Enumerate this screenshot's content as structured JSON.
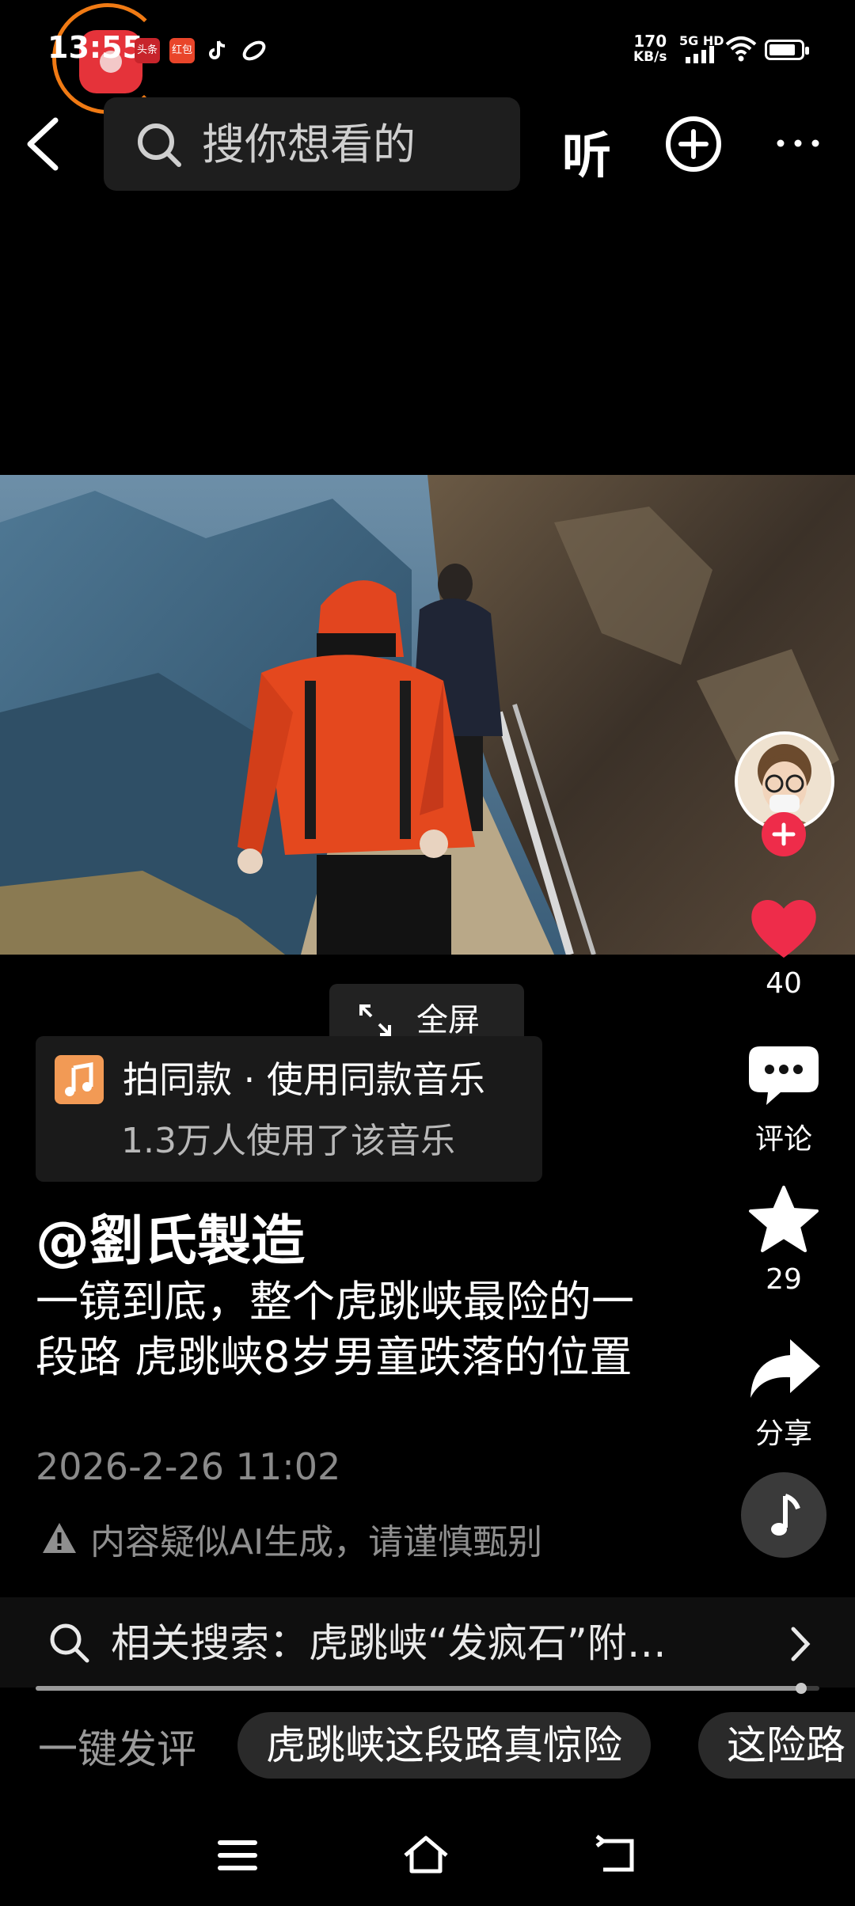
{
  "status_bar": {
    "time": "13:55",
    "net_speed_value": "170",
    "net_speed_unit": "KB/s",
    "network": "5G HD",
    "mini_apps": [
      "头条",
      "红包",
      "TikTok",
      "Link"
    ]
  },
  "top_bar": {
    "search_placeholder": "搜你想看的",
    "listen_label": "听"
  },
  "video": {
    "fullscreen_label": "全屏"
  },
  "right_rail": {
    "like_count": "40",
    "comment_label": "评论",
    "favorite_count": "29",
    "share_label": "分享"
  },
  "music_card": {
    "title": "拍同款 · 使用同款音乐",
    "subtitle": "1.3万人使用了该音乐"
  },
  "post": {
    "author": "@劉氏製造",
    "description": "一镜到底，整个虎跳峡最险的一段路 虎跳峡8岁男童跌落的位置",
    "date": "2026-2-26 11:02",
    "ai_notice": "内容疑似AI生成，请谨慎甄别"
  },
  "related_search": {
    "text": "相关搜索：虎跳峡“发疯石”附…"
  },
  "progress": {
    "fraction": 0.976
  },
  "quick_comment": {
    "label": "一键发评",
    "chips": [
      "虎跳峡这段路真惊险",
      "这险路"
    ]
  },
  "colors": {
    "like_red": "#ee2c4a",
    "music_icon": "#f29a55",
    "record_ring": "#f07a14"
  }
}
